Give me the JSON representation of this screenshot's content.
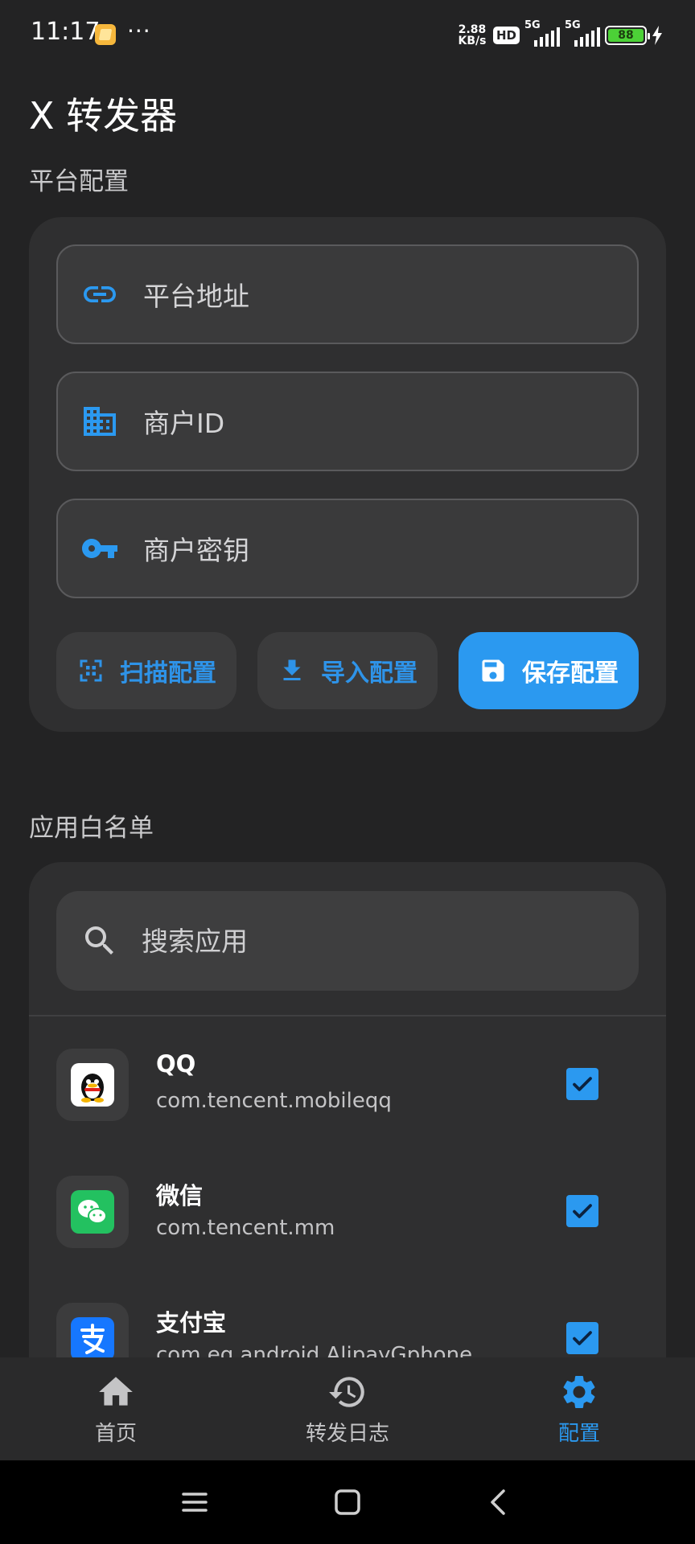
{
  "status": {
    "time": "11:17",
    "more": "···",
    "net_speed_value": "2.88",
    "net_speed_unit": "KB/s",
    "hd": "HD",
    "sim1": "5G",
    "sim2": "5G",
    "battery": "88"
  },
  "app_title": "X 转发器",
  "platform": {
    "section_label": "平台配置",
    "fields": [
      {
        "icon": "link-icon",
        "placeholder": "平台地址"
      },
      {
        "icon": "building-icon",
        "placeholder": "商户ID"
      },
      {
        "icon": "key-icon",
        "placeholder": "商户密钥"
      }
    ],
    "buttons": {
      "scan": "扫描配置",
      "import": "导入配置",
      "save": "保存配置"
    }
  },
  "whitelist": {
    "section_label": "应用白名单",
    "search_placeholder": "搜索应用",
    "apps": [
      {
        "name": "QQ",
        "package": "com.tencent.mobileqq",
        "checked": true,
        "icon": "qq-icon"
      },
      {
        "name": "微信",
        "package": "com.tencent.mm",
        "checked": true,
        "icon": "wechat-icon"
      },
      {
        "name": "支付宝",
        "package": "com.eg.android.AlipayGphone",
        "checked": true,
        "icon": "alipay-icon"
      }
    ]
  },
  "nav": {
    "home": "首页",
    "logs": "转发日志",
    "config": "配置",
    "active": "config"
  },
  "colors": {
    "accent": "#2b99f0",
    "background": "#232324",
    "card": "#2f2f30"
  }
}
